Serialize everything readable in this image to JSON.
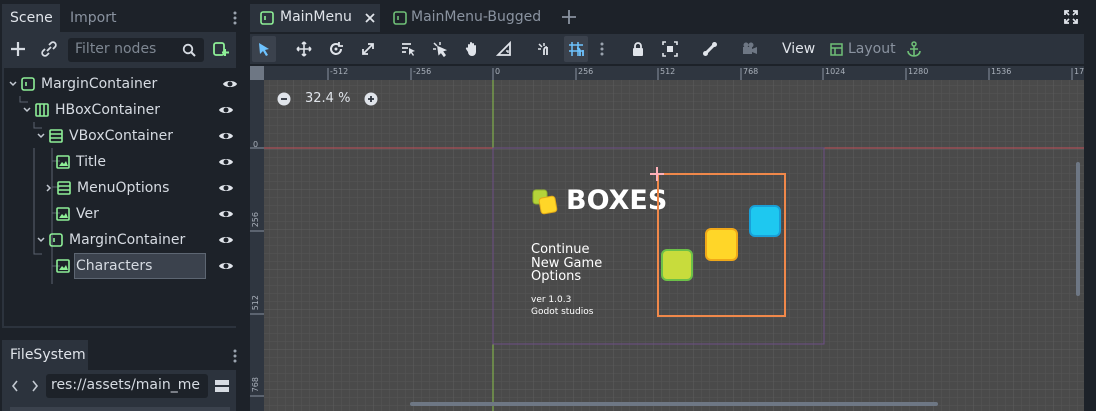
{
  "scene_panel": {
    "tabs": [
      "Scene",
      "Import"
    ],
    "filter_placeholder": "Filter nodes",
    "tree": [
      {
        "label": "MarginContainer",
        "depth": 0,
        "icon": "margincontainer-icon"
      },
      {
        "label": "HBoxContainer",
        "depth": 1,
        "icon": "hboxcontainer-icon"
      },
      {
        "label": "VBoxContainer",
        "depth": 2,
        "icon": "vboxcontainer-icon"
      },
      {
        "label": "Title",
        "depth": 3,
        "icon": "texturerect-icon"
      },
      {
        "label": "MenuOptions",
        "depth": 3,
        "icon": "vboxcontainer-icon"
      },
      {
        "label": "Ver",
        "depth": 3,
        "icon": "texturerect-icon"
      },
      {
        "label": "MarginContainer",
        "depth": 2,
        "icon": "margincontainer-icon"
      },
      {
        "label": "Characters",
        "depth": 3,
        "icon": "texturerect-icon"
      }
    ]
  },
  "filesystem_panel": {
    "tab": "FileSystem",
    "path": "res://assets/main_me"
  },
  "editor_tabs": [
    "MainMenu",
    "MainMenu-Bugged"
  ],
  "toolbar": {
    "view_label": "View",
    "layout_label": "Layout"
  },
  "viewport": {
    "zoom_label": "32.4 %",
    "ruler_top": [
      "-512",
      "-256",
      "0",
      "256",
      "512",
      "768",
      "1024",
      "1280",
      "1536",
      "17"
    ],
    "ruler_left": [
      "0",
      "256",
      "512",
      "768"
    ]
  },
  "game_preview": {
    "title": "BOXES",
    "menu": [
      "Continue",
      "New Game",
      "Options"
    ],
    "version": "ver 1.0.3",
    "studio": "Godot studios",
    "colors": {
      "green": "#c8dc3c",
      "yellow": "#ffd628",
      "cyan": "#1ec8f0",
      "selection": "#f0884a"
    }
  }
}
